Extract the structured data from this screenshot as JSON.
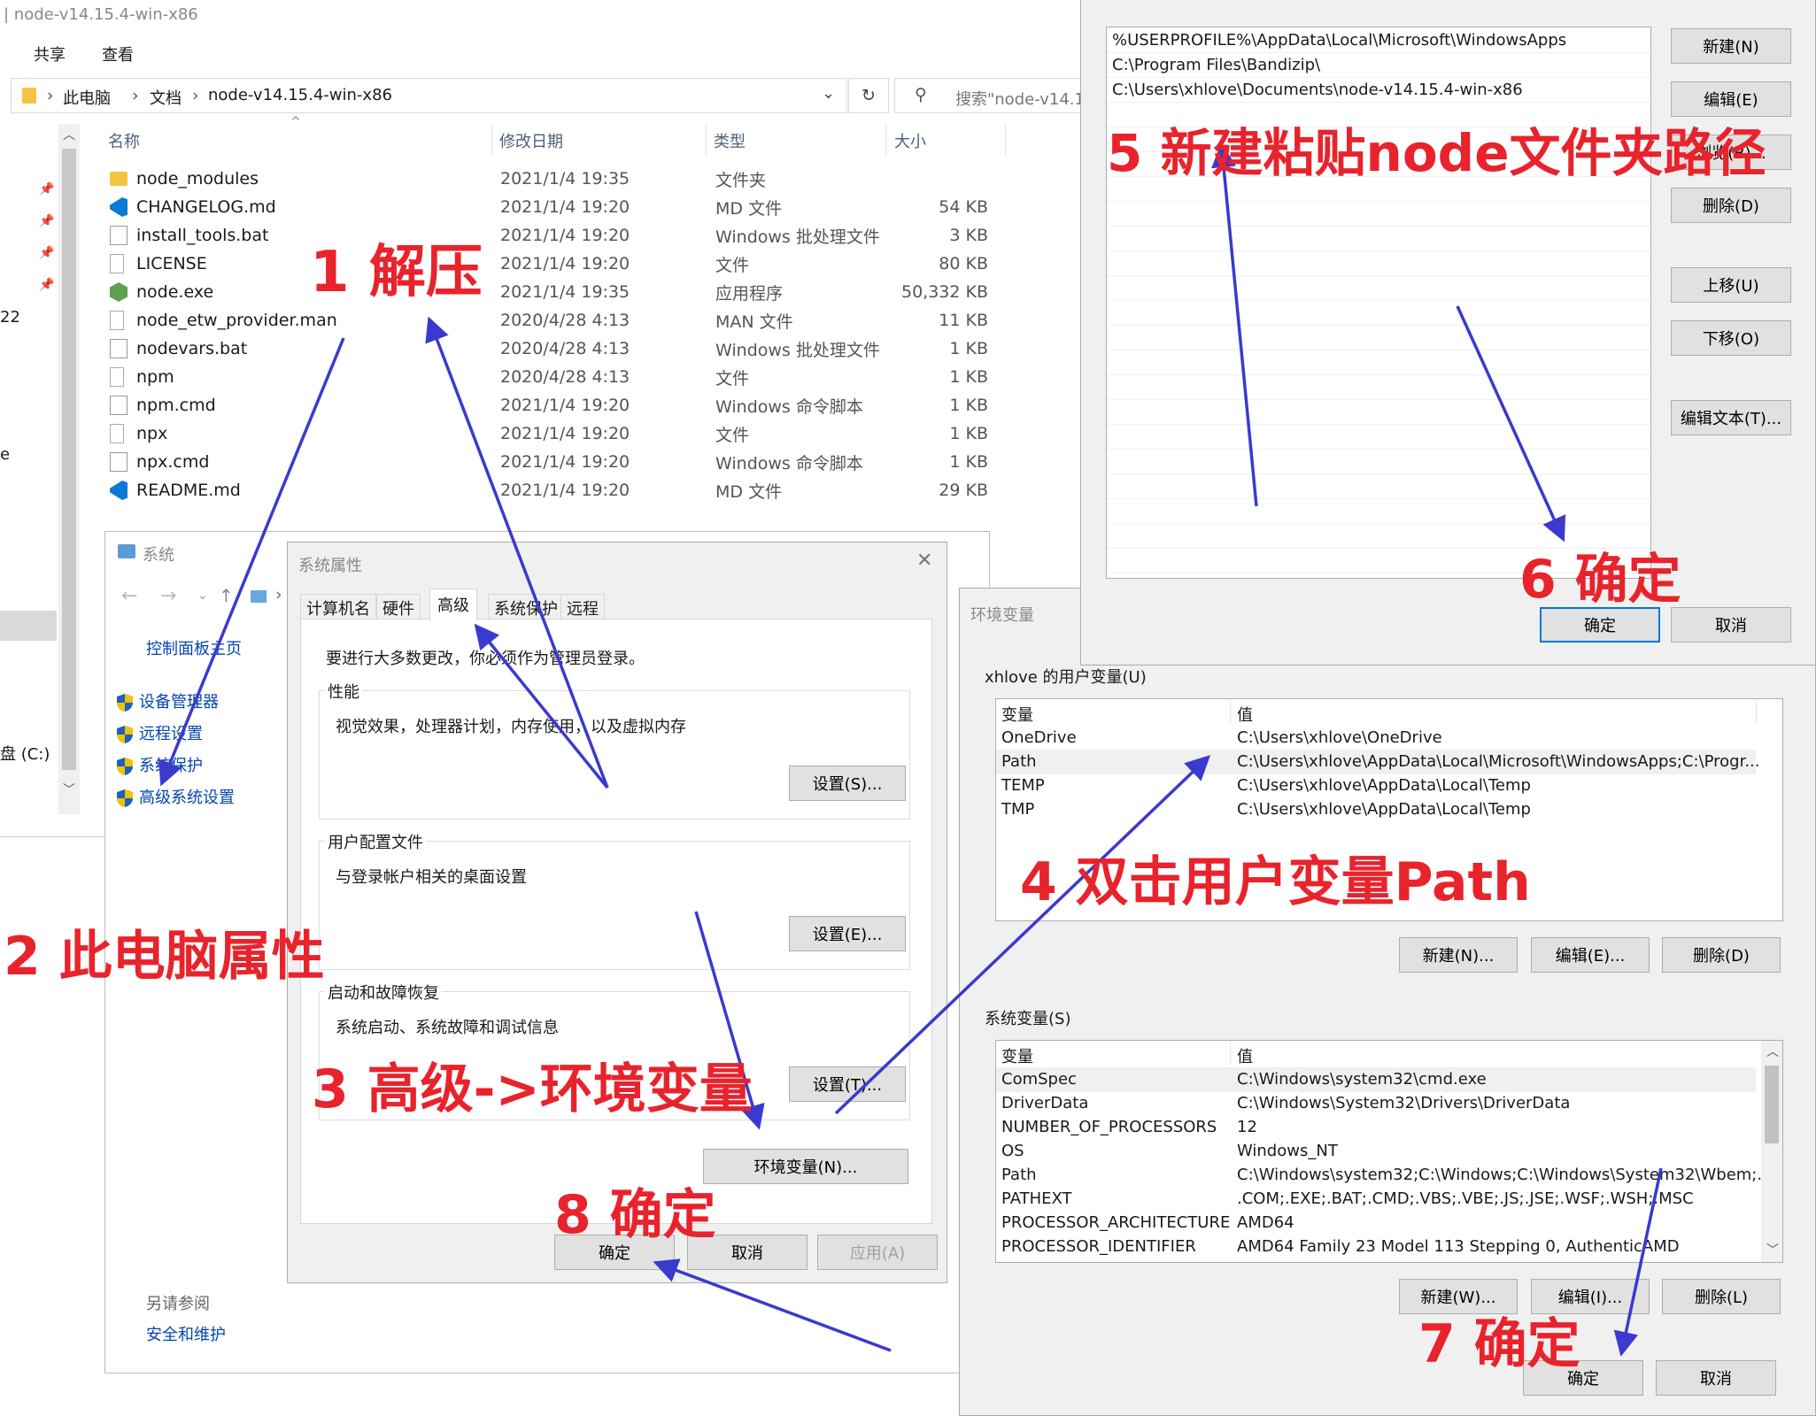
{
  "explorer": {
    "title": "node-v14.15.4-win-x86",
    "ribbon": [
      "共享",
      "查看"
    ],
    "breadcrumb": [
      "此电脑",
      "文档",
      "node-v14.15.4-win-x86"
    ],
    "search_placeholder": "搜索\"node-v14.1",
    "columns": {
      "name": "名称",
      "date": "修改日期",
      "type": "类型",
      "size": "大小"
    },
    "files": [
      {
        "name": "node_modules",
        "date": "2021/1/4 19:35",
        "type": "文件夹",
        "size": "",
        "icon": "folder-icon"
      },
      {
        "name": "CHANGELOG.md",
        "date": "2021/1/4 19:20",
        "type": "MD 文件",
        "size": "54 KB",
        "icon": "vscode-icon"
      },
      {
        "name": "install_tools.bat",
        "date": "2021/1/4 19:20",
        "type": "Windows 批处理文件",
        "size": "3 KB",
        "icon": "batch-file-icon"
      },
      {
        "name": "LICENSE",
        "date": "2021/1/4 19:20",
        "type": "文件",
        "size": "80 KB",
        "icon": "file-icon"
      },
      {
        "name": "node.exe",
        "date": "2021/1/4 19:35",
        "type": "应用程序",
        "size": "50,332 KB",
        "icon": "node-icon"
      },
      {
        "name": "node_etw_provider.man",
        "date": "2020/4/28 4:13",
        "type": "MAN 文件",
        "size": "11 KB",
        "icon": "file-icon"
      },
      {
        "name": "nodevars.bat",
        "date": "2020/4/28 4:13",
        "type": "Windows 批处理文件",
        "size": "1 KB",
        "icon": "batch-file-icon"
      },
      {
        "name": "npm",
        "date": "2020/4/28 4:13",
        "type": "文件",
        "size": "1 KB",
        "icon": "file-icon"
      },
      {
        "name": "npm.cmd",
        "date": "2021/1/4 19:20",
        "type": "Windows 命令脚本",
        "size": "1 KB",
        "icon": "batch-file-icon"
      },
      {
        "name": "npx",
        "date": "2021/1/4 19:20",
        "type": "文件",
        "size": "1 KB",
        "icon": "file-icon"
      },
      {
        "name": "npx.cmd",
        "date": "2021/1/4 19:20",
        "type": "Windows 命令脚本",
        "size": "1 KB",
        "icon": "batch-file-icon"
      },
      {
        "name": "README.md",
        "date": "2021/1/4 19:20",
        "type": "MD 文件",
        "size": "29 KB",
        "icon": "vscode-icon"
      }
    ],
    "left_labels": {
      "num": "22",
      "drive": "盘 (C:)",
      "e": "e"
    }
  },
  "system": {
    "title": "系统",
    "home_link": "控制面板主页",
    "links": [
      "设备管理器",
      "远程设置",
      "系统保护",
      "高级系统设置"
    ],
    "see_also": "另请参阅",
    "security": "安全和维护"
  },
  "sysprops": {
    "title": "系统属性",
    "tabs": [
      "计算机名",
      "硬件",
      "高级",
      "系统保护",
      "远程"
    ],
    "admin_note": "要进行大多数更改，你必须作为管理员登录。",
    "perf_title": "性能",
    "perf_desc": "视觉效果，处理器计划，内存使用，以及虚拟内存",
    "perf_btn": "设置(S)...",
    "profile_title": "用户配置文件",
    "profile_desc": "与登录帐户相关的桌面设置",
    "profile_btn": "设置(E)...",
    "startup_title": "启动和故障恢复",
    "startup_desc": "系统启动、系统故障和调试信息",
    "startup_btn": "设置(T)...",
    "env_btn": "环境变量(N)...",
    "ok": "确定",
    "cancel": "取消",
    "apply": "应用(A)"
  },
  "envvars": {
    "title": "环境变量",
    "user_label": "xhlove 的用户变量(U)",
    "col_var": "变量",
    "col_val": "值",
    "user_vars": [
      {
        "name": "OneDrive",
        "value": "C:\\Users\\xhlove\\OneDrive"
      },
      {
        "name": "Path",
        "value": "C:\\Users\\xhlove\\AppData\\Local\\Microsoft\\WindowsApps;C:\\Progr..."
      },
      {
        "name": "TEMP",
        "value": "C:\\Users\\xhlove\\AppData\\Local\\Temp"
      },
      {
        "name": "TMP",
        "value": "C:\\Users\\xhlove\\AppData\\Local\\Temp"
      }
    ],
    "user_btns": [
      "新建(N)...",
      "编辑(E)...",
      "删除(D)"
    ],
    "sys_label": "系统变量(S)",
    "sys_vars": [
      {
        "name": "ComSpec",
        "value": "C:\\Windows\\system32\\cmd.exe"
      },
      {
        "name": "DriverData",
        "value": "C:\\Windows\\System32\\Drivers\\DriverData"
      },
      {
        "name": "NUMBER_OF_PROCESSORS",
        "value": "12"
      },
      {
        "name": "OS",
        "value": "Windows_NT"
      },
      {
        "name": "Path",
        "value": "C:\\Windows\\system32;C:\\Windows;C:\\Windows\\System32\\Wbem;..."
      },
      {
        "name": "PATHEXT",
        "value": ".COM;.EXE;.BAT;.CMD;.VBS;.VBE;.JS;.JSE;.WSF;.WSH;.MSC"
      },
      {
        "name": "PROCESSOR_ARCHITECTURE",
        "value": "AMD64"
      },
      {
        "name": "PROCESSOR_IDENTIFIER",
        "value": "AMD64 Family 23 Model 113 Stepping 0, AuthenticAMD"
      }
    ],
    "sys_btns": [
      "新建(W)...",
      "编辑(I)...",
      "删除(L)"
    ],
    "ok": "确定",
    "cancel": "取消"
  },
  "editpath": {
    "entries": [
      "%USERPROFILE%\\AppData\\Local\\Microsoft\\WindowsApps",
      "C:\\Program Files\\Bandizip\\",
      "C:\\Users\\xhlove\\Documents\\node-v14.15.4-win-x86"
    ],
    "btns": [
      "新建(N)",
      "编辑(E)",
      "浏览(B)...",
      "删除(D)",
      "上移(U)",
      "下移(O)",
      "编辑文本(T)..."
    ],
    "ok": "确定",
    "cancel": "取消"
  },
  "annotations": {
    "a1": "1 解压",
    "a2": "2 此电脑属性",
    "a3": "3 高级->环境变量",
    "a4": "4 双击用户变量Path",
    "a5": "5 新建粘贴node文件夹路径",
    "a6": "6 确定",
    "a7": "7 确定",
    "a8": "8 确定"
  },
  "colors": {
    "annotation": "#e8232c",
    "arrow": "#3a3acf",
    "link": "#0645ad",
    "accent": "#0078d7"
  }
}
